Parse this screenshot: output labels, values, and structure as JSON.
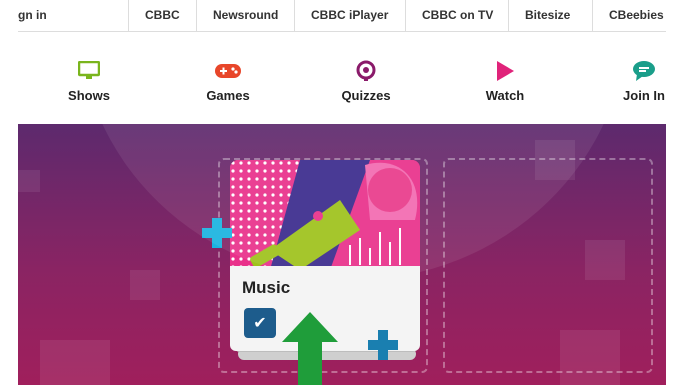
{
  "top_nav": {
    "items": [
      "gn in",
      "CBBC",
      "Newsround",
      "CBBC iPlayer",
      "CBBC on TV",
      "Bitesize",
      "CBeebies"
    ]
  },
  "category_nav": {
    "items": [
      {
        "label": "Shows",
        "icon": "tv-icon",
        "color": "#7ab51d"
      },
      {
        "label": "Games",
        "icon": "gamepad-icon",
        "color": "#e8462a"
      },
      {
        "label": "Quizzes",
        "icon": "quiz-icon",
        "color": "#8a1a6a"
      },
      {
        "label": "Watch",
        "icon": "play-icon",
        "color": "#e0237a"
      },
      {
        "label": "Join In",
        "icon": "chat-icon",
        "color": "#1a9e8a"
      }
    ]
  },
  "card": {
    "title": "Music",
    "check_icon": "checkmark-icon"
  },
  "colors": {
    "card_top": "#e9308a",
    "check_bg": "#1d5c8c",
    "accent_green": "#9ec21b",
    "accent_blue": "#1ab3e0"
  }
}
